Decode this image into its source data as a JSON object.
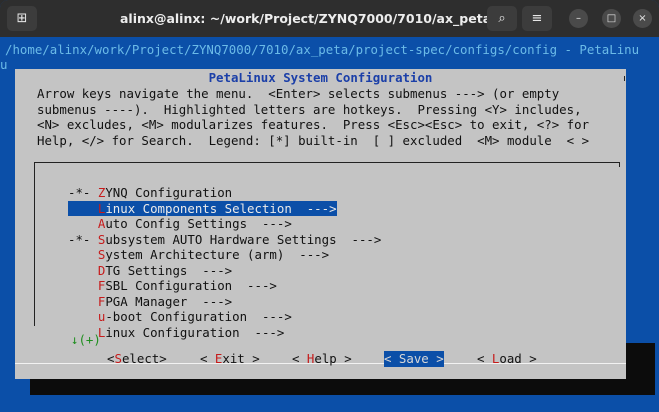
{
  "window": {
    "title": "alinx@alinx: ~/work/Project/ZYNQ7000/7010/ax_peta",
    "new_tab_glyph": "⊞",
    "search_glyph": "⌕",
    "menu_glyph": "≡",
    "minimize_glyph": "–",
    "maximize_glyph": "□",
    "close_glyph": "×"
  },
  "terminal": {
    "path_line": "/home/alinx/work/Project/ZYNQ7000/7010/ax_peta/project-spec/configs/config - PetaLinu",
    "second_line": "u",
    "bg_color": "#0b4fa8"
  },
  "dialog": {
    "title": "PetaLinux System Configuration",
    "help_lines": [
      "Arrow keys navigate the menu.  <Enter> selects submenus ---> (or empty",
      "submenus ----).  Highlighted letters are hotkeys.  Pressing <Y> includes,",
      "<N> excludes, <M> modularizes features.  Press <Esc><Esc> to exit, <?> for",
      "Help, </> for Search.  Legend: [*] built-in  [ ] excluded  <M> module  < >"
    ],
    "menu_items": [
      {
        "prefix": "-*- ",
        "hot": "Z",
        "rest": "YNQ Configuration",
        "selected": false
      },
      {
        "prefix": "    ",
        "hot": "L",
        "rest": "inux Components Selection  --->",
        "selected": true
      },
      {
        "prefix": "    ",
        "hot": "A",
        "rest": "uto Config Settings  --->",
        "selected": false
      },
      {
        "prefix": "-*- ",
        "hot": "S",
        "rest": "ubsystem AUTO Hardware Settings  --->",
        "selected": false
      },
      {
        "prefix": "    ",
        "hot": "S",
        "rest": "ystem Architecture (arm)  --->",
        "selected": false
      },
      {
        "prefix": "    ",
        "hot": "D",
        "rest": "TG Settings  --->",
        "selected": false
      },
      {
        "prefix": "    ",
        "hot": "F",
        "rest": "SBL Configuration  --->",
        "selected": false
      },
      {
        "prefix": "    ",
        "hot": "F",
        "rest": "PGA Manager  --->",
        "selected": false
      },
      {
        "prefix": "    ",
        "hot": "u",
        "rest": "-boot Configuration  --->",
        "selected": false
      },
      {
        "prefix": "    ",
        "hot": "L",
        "rest": "inux Configuration  --->",
        "selected": false
      }
    ],
    "more_indicator": "↓(+)",
    "buttons": [
      {
        "open": "<",
        "hot": "S",
        "rest": "elect>",
        "active": false
      },
      {
        "open": "< ",
        "hot": "E",
        "rest": "xit >",
        "active": false
      },
      {
        "open": "< ",
        "hot": "H",
        "rest": "elp >",
        "active": false
      },
      {
        "open": "< ",
        "hot": "S",
        "rest": "ave >",
        "active": true
      },
      {
        "open": "< ",
        "hot": "L",
        "rest": "oad >",
        "active": false
      }
    ]
  }
}
